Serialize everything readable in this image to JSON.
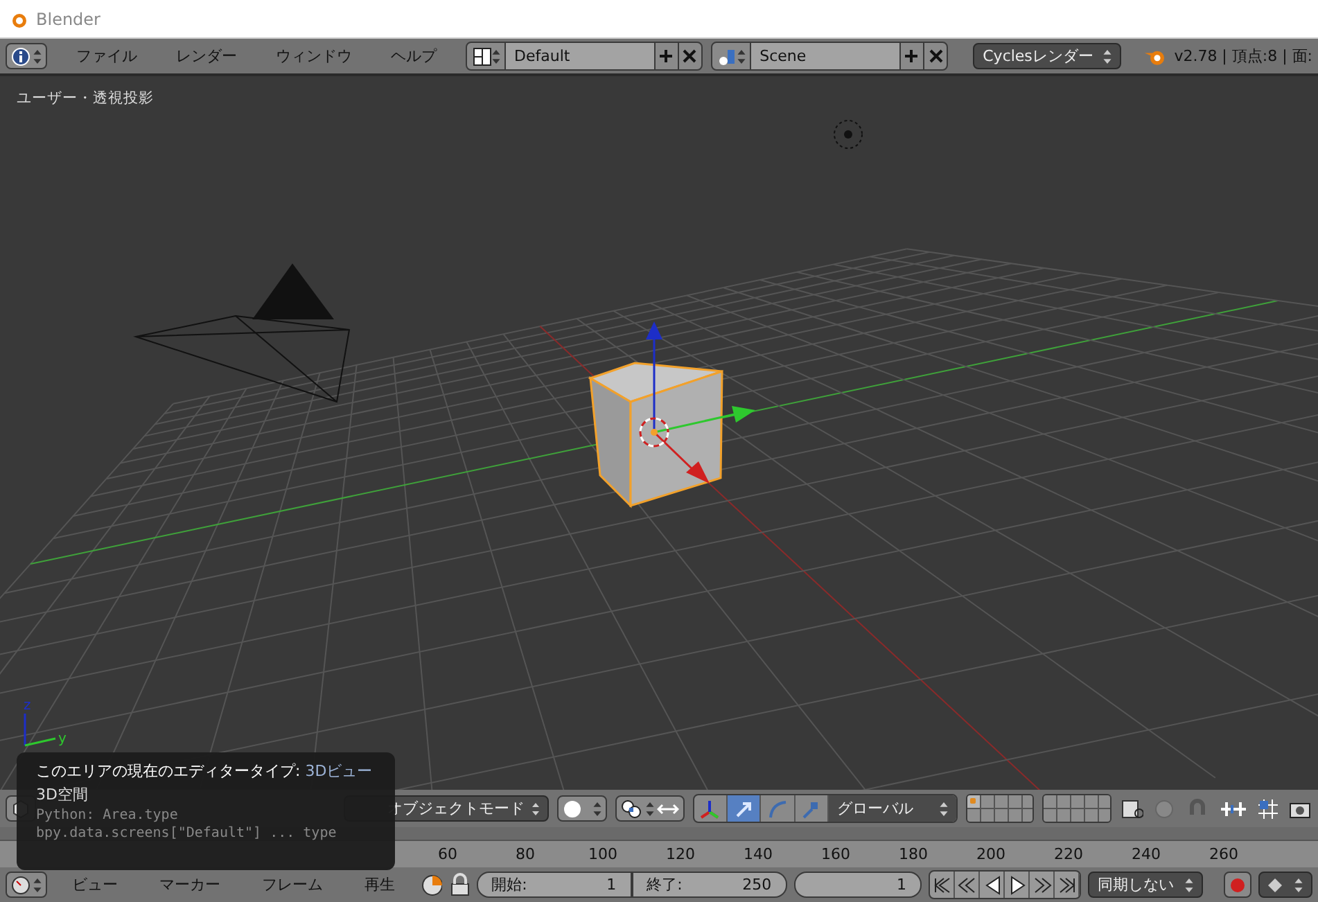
{
  "window": {
    "title": "Blender"
  },
  "top_bar": {
    "menus": [
      "ファイル",
      "レンダー",
      "ウィンドウ",
      "ヘルプ"
    ],
    "screen": {
      "value": "Default"
    },
    "scene": {
      "value": "Scene"
    },
    "render_engine": "Cyclesレンダー",
    "stats": "v2.78 | 頂点:8 | 面:"
  },
  "viewport": {
    "label": "ユーザー・透視投影",
    "axis_labels": [
      "z",
      "y"
    ]
  },
  "view3d_header": {
    "mode": "オブジェクトモード",
    "manipulators": [
      {
        "kind": "toggle",
        "selected": false
      },
      {
        "kind": "translate",
        "selected": true
      },
      {
        "kind": "rotate",
        "selected": false
      },
      {
        "kind": "scale",
        "selected": false
      }
    ],
    "orientation": "グローバル",
    "layers": [
      {
        "selected": true
      },
      {
        "selected": false
      },
      {
        "selected": false
      },
      {
        "selected": false
      },
      {
        "selected": false
      },
      {
        "selected": false
      },
      {
        "selected": false
      },
      {
        "selected": false
      },
      {
        "selected": false
      },
      {
        "selected": false
      },
      {
        "selected": false
      },
      {
        "selected": false
      },
      {
        "selected": false
      },
      {
        "selected": false
      },
      {
        "selected": false
      },
      {
        "selected": false
      },
      {
        "selected": false
      },
      {
        "selected": false
      },
      {
        "selected": false
      },
      {
        "selected": false
      }
    ]
  },
  "timeline": {
    "ruler_labels": [
      "60",
      "80",
      "100",
      "120",
      "140",
      "160",
      "180",
      "200",
      "220",
      "240",
      "260"
    ],
    "menus": [
      "ビュー",
      "マーカー",
      "フレーム",
      "再生"
    ],
    "start": {
      "label": "開始:",
      "value": "1"
    },
    "end": {
      "label": "終了:",
      "value": "250"
    },
    "current_frame": "1",
    "sync": "同期しない"
  },
  "tooltip": {
    "title": "このエリアの現在のエディタータイプ:",
    "value": "3Dビュー",
    "description": "3D空間",
    "python": "Python: Area.type",
    "path": "bpy.data.screens[\"Default\"] ... type"
  }
}
